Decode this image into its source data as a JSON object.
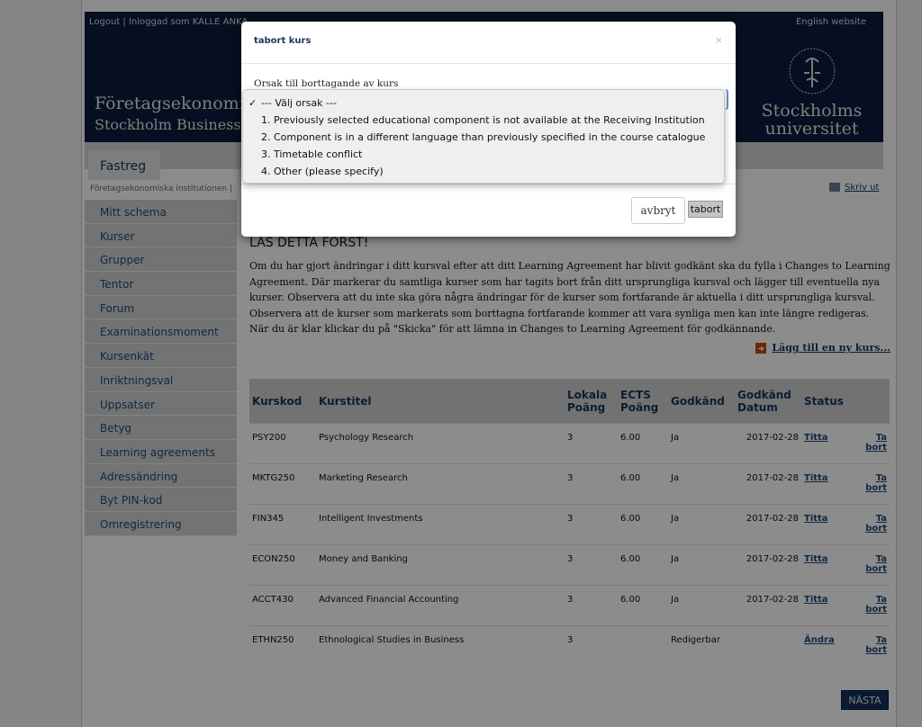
{
  "header": {
    "logout": "Logout",
    "logged_in": "Inloggad som KALLE ANKA",
    "english": "English website",
    "dept_line1": "Företagsekonomiska",
    "dept_line2": "Stockholm Business School",
    "logo_name_line1": "Stockholms",
    "logo_name_line2": "universitet",
    "brand_color": "#0a1c3d"
  },
  "nav": {
    "tab": "Fastreg",
    "breadcrumb": "Företagsekonomiska institutionen |",
    "print": "Skriv ut"
  },
  "sidebar": {
    "items": [
      {
        "label": "Mitt schema"
      },
      {
        "label": "Kurser"
      },
      {
        "label": "Grupper"
      },
      {
        "label": "Tentor"
      },
      {
        "label": "Forum"
      },
      {
        "label": "Examinationsmoment"
      },
      {
        "label": "Kursenkät"
      },
      {
        "label": "Inriktningsval"
      },
      {
        "label": "Uppsatser"
      },
      {
        "label": "Betyg"
      },
      {
        "label": "Learning agreements"
      },
      {
        "label": "Adressändring"
      },
      {
        "label": "Byt PIN-kod"
      },
      {
        "label": "Omregistrering"
      }
    ]
  },
  "main": {
    "title": "LÄS DETTA FÖRST!",
    "intro": "Om du har gjort ändringar i ditt kursval efter att ditt Learning Agreement har blivit godkänt ska du fylla i Changes to Learning Agreement. Där markerar du samtliga kurser som har tagits bort från ditt ursprungliga kursval och lägger till eventuella nya kurser. Observera att du inte ska göra några ändringar för de kurser som fortfarande är aktuella i ditt ursprungliga kursval. Observera att de kurser som markerats som borttagna fortfarande kommer att vara synliga men kan inte längre redigeras. När du är klar klickar du på \"Skicka\" för att lämna in Changes to Learning Agreement för godkännande.",
    "add_course": "Lägg till en ny kurs...",
    "table": {
      "headers": [
        "Kurskod",
        "Kurstitel",
        "Lokala Poäng",
        "ECTS Poäng",
        "Godkänd",
        "Godkänd Datum",
        "Status",
        ""
      ],
      "rows": [
        {
          "code": "PSY200",
          "title": "Psychology Research",
          "local": "3",
          "ects": "6.00",
          "approved": "Ja",
          "date": "2017-02-28",
          "status": "Titta",
          "action": "Ta bort"
        },
        {
          "code": "MKTG250",
          "title": "Marketing Research",
          "local": "3",
          "ects": "6.00",
          "approved": "Ja",
          "date": "2017-02-28",
          "status": "Titta",
          "action": "Ta bort"
        },
        {
          "code": "FIN345",
          "title": "Intelligent Investments",
          "local": "3",
          "ects": "6.00",
          "approved": "Ja",
          "date": "2017-02-28",
          "status": "Titta",
          "action": "Ta bort"
        },
        {
          "code": "ECON250",
          "title": "Money and Banking",
          "local": "3",
          "ects": "6.00",
          "approved": "Ja",
          "date": "2017-02-28",
          "status": "Titta",
          "action": "Ta bort"
        },
        {
          "code": "ACCT430",
          "title": "Advanced Financial Accounting",
          "local": "3",
          "ects": "6.00",
          "approved": "Ja",
          "date": "2017-02-28",
          "status": "Titta",
          "action": "Ta bort"
        },
        {
          "code": "ETHN250",
          "title": "Ethnological Studies in Business",
          "local": "3",
          "ects": "",
          "approved": "Redigerbar",
          "date": "",
          "status": "Ändra",
          "action": "Ta bort"
        }
      ]
    },
    "next": "NÄSTA"
  },
  "modal": {
    "title": "tabort kurs",
    "close": "×",
    "label": "Orsak till borttagande av kurs",
    "selected": "--- Välj orsak ---",
    "options": [
      "--- Välj orsak ---",
      "1. Previously selected educational component is not available at the Receiving Institution",
      "2. Component is in a different language than previously specified in the course catalogue",
      "3. Timetable conflict",
      "4. Other (please specify)"
    ],
    "cancel": "avbryt",
    "remove": "tabort"
  }
}
